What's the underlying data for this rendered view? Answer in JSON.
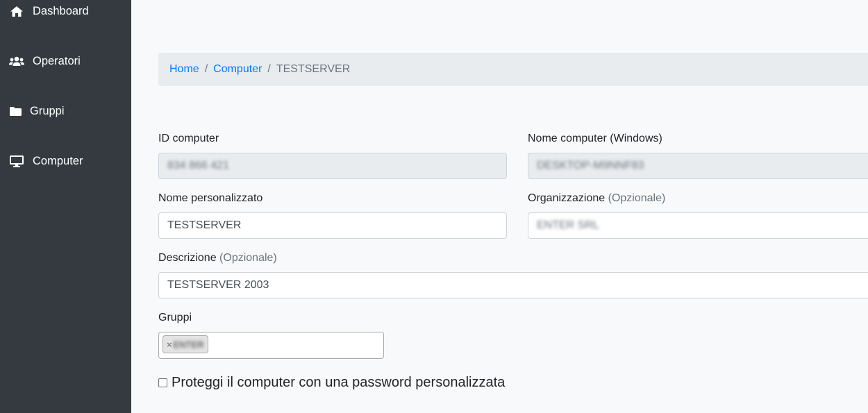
{
  "sidebar": {
    "items": [
      {
        "label": "Dashboard",
        "icon": "home-icon"
      },
      {
        "label": "Operatori",
        "icon": "users-icon"
      },
      {
        "label": "Gruppi",
        "icon": "folder-icon"
      },
      {
        "label": "Computer",
        "icon": "monitor-icon"
      }
    ]
  },
  "breadcrumb": {
    "home": "Home",
    "computer": "Computer",
    "separator": "/",
    "current": "TESTSERVER"
  },
  "form": {
    "id_label": "ID computer",
    "id_value": "834 866 421",
    "windows_name_label": "Nome computer (Windows)",
    "windows_name_value": "DESKTOP-M9NNF83",
    "custom_name_label": "Nome personalizzato",
    "custom_name_value": "TESTSERVER",
    "org_label": "Organizzazione",
    "optional_label": "(Opzionale)",
    "org_value": "ENTER SRL",
    "desc_label": "Descrizione",
    "desc_value": "TESTSERVER 2003",
    "groups_label": "Gruppi",
    "group_tag_remove": "×",
    "group_tag": "ENTER",
    "password_checkbox_label": "Proteggi il computer con una password personalizzata"
  }
}
